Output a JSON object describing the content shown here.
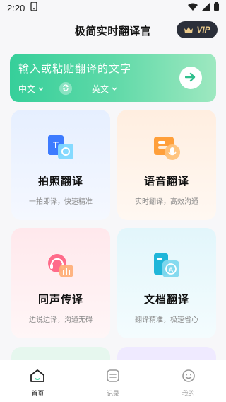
{
  "status_bar": {
    "time": "2:20"
  },
  "header": {
    "title": "极简实时翻译官",
    "vip_label": "VIP"
  },
  "input_banner": {
    "placeholder": "输入或粘贴翻译的文字",
    "source_lang": "中文",
    "target_lang": "英文"
  },
  "features": [
    {
      "title": "拍照翻译",
      "subtitle": "一拍即译，快速精准"
    },
    {
      "title": "语音翻译",
      "subtitle": "实时翻译，高效沟通"
    },
    {
      "title": "同声传译",
      "subtitle": "边说边译，沟通无碍"
    },
    {
      "title": "文档翻译",
      "subtitle": "翻译精准，极速省心"
    }
  ],
  "bottom_nav": [
    {
      "label": "首页",
      "icon": "home-icon",
      "active": true
    },
    {
      "label": "记录",
      "icon": "record-icon",
      "active": false
    },
    {
      "label": "我的",
      "icon": "profile-icon",
      "active": false
    }
  ],
  "colors": {
    "accent_green": "#36cf9a",
    "vip_gold": "#e9c98b",
    "vip_bg": "#2b2f3a"
  }
}
